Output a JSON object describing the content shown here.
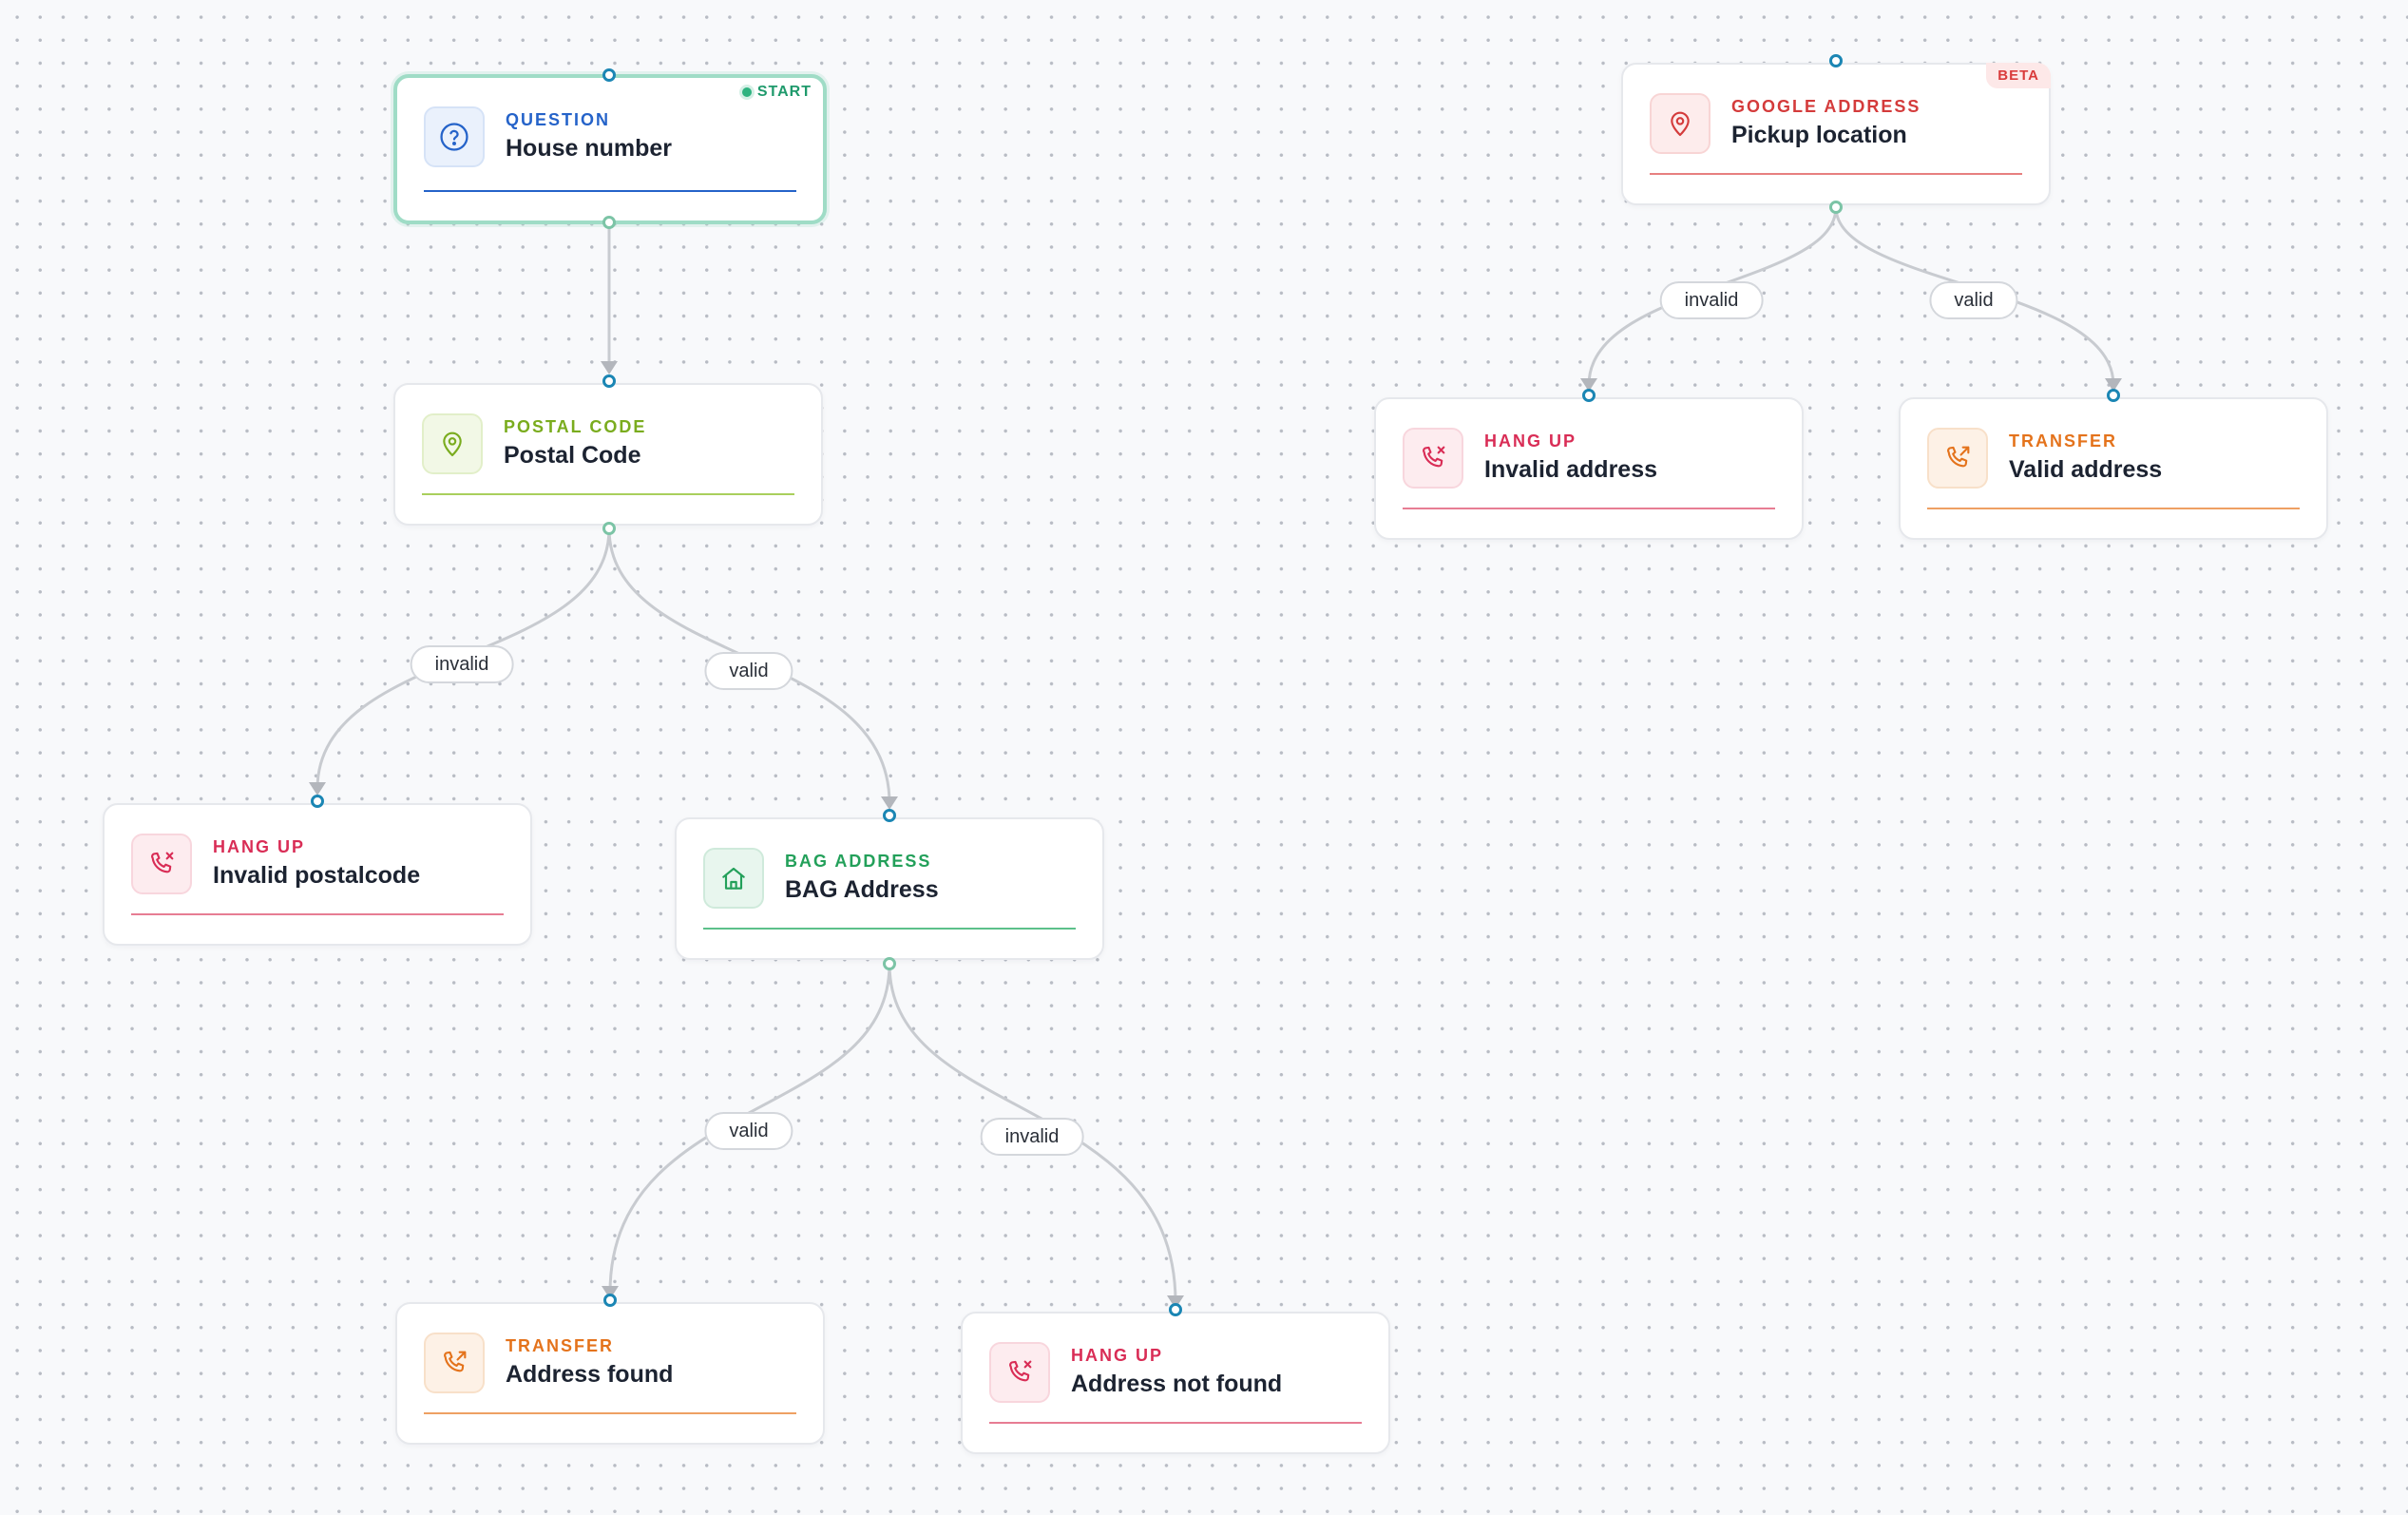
{
  "colors": {
    "question": "#2563c9",
    "postal": "#7aac1e",
    "bag": "#23a05a",
    "google": "#d43b3b",
    "hangup": "#d92d56",
    "transfer": "#e4731c",
    "start": "#2fb380",
    "edge": "#c8cbd0"
  },
  "nodes": {
    "house_number": {
      "type": "QUESTION",
      "title": "House number",
      "badge": "START",
      "icon": "question-icon"
    },
    "postal_code": {
      "type": "POSTAL CODE",
      "title": "Postal Code",
      "icon": "map-pin-icon"
    },
    "invalid_postalcode": {
      "type": "HANG UP",
      "title": "Invalid postalcode",
      "icon": "phone-hangup-icon"
    },
    "bag_address": {
      "type": "BAG ADDRESS",
      "title": "BAG Address",
      "icon": "home-icon"
    },
    "address_found": {
      "type": "TRANSFER",
      "title": "Address found",
      "icon": "phone-transfer-icon"
    },
    "address_not_found": {
      "type": "HANG UP",
      "title": "Address not found",
      "icon": "phone-hangup-icon"
    },
    "pickup_location": {
      "type": "GOOGLE ADDRESS",
      "title": "Pickup location",
      "badge": "BETA",
      "icon": "map-pin-icon"
    },
    "invalid_address": {
      "type": "HANG UP",
      "title": "Invalid address",
      "icon": "phone-hangup-icon"
    },
    "valid_address": {
      "type": "TRANSFER",
      "title": "Valid address",
      "icon": "phone-transfer-icon"
    }
  },
  "edges": {
    "postal_invalid": "invalid",
    "postal_valid": "valid",
    "bag_valid": "valid",
    "bag_invalid": "invalid",
    "google_invalid": "invalid",
    "google_valid": "valid"
  }
}
